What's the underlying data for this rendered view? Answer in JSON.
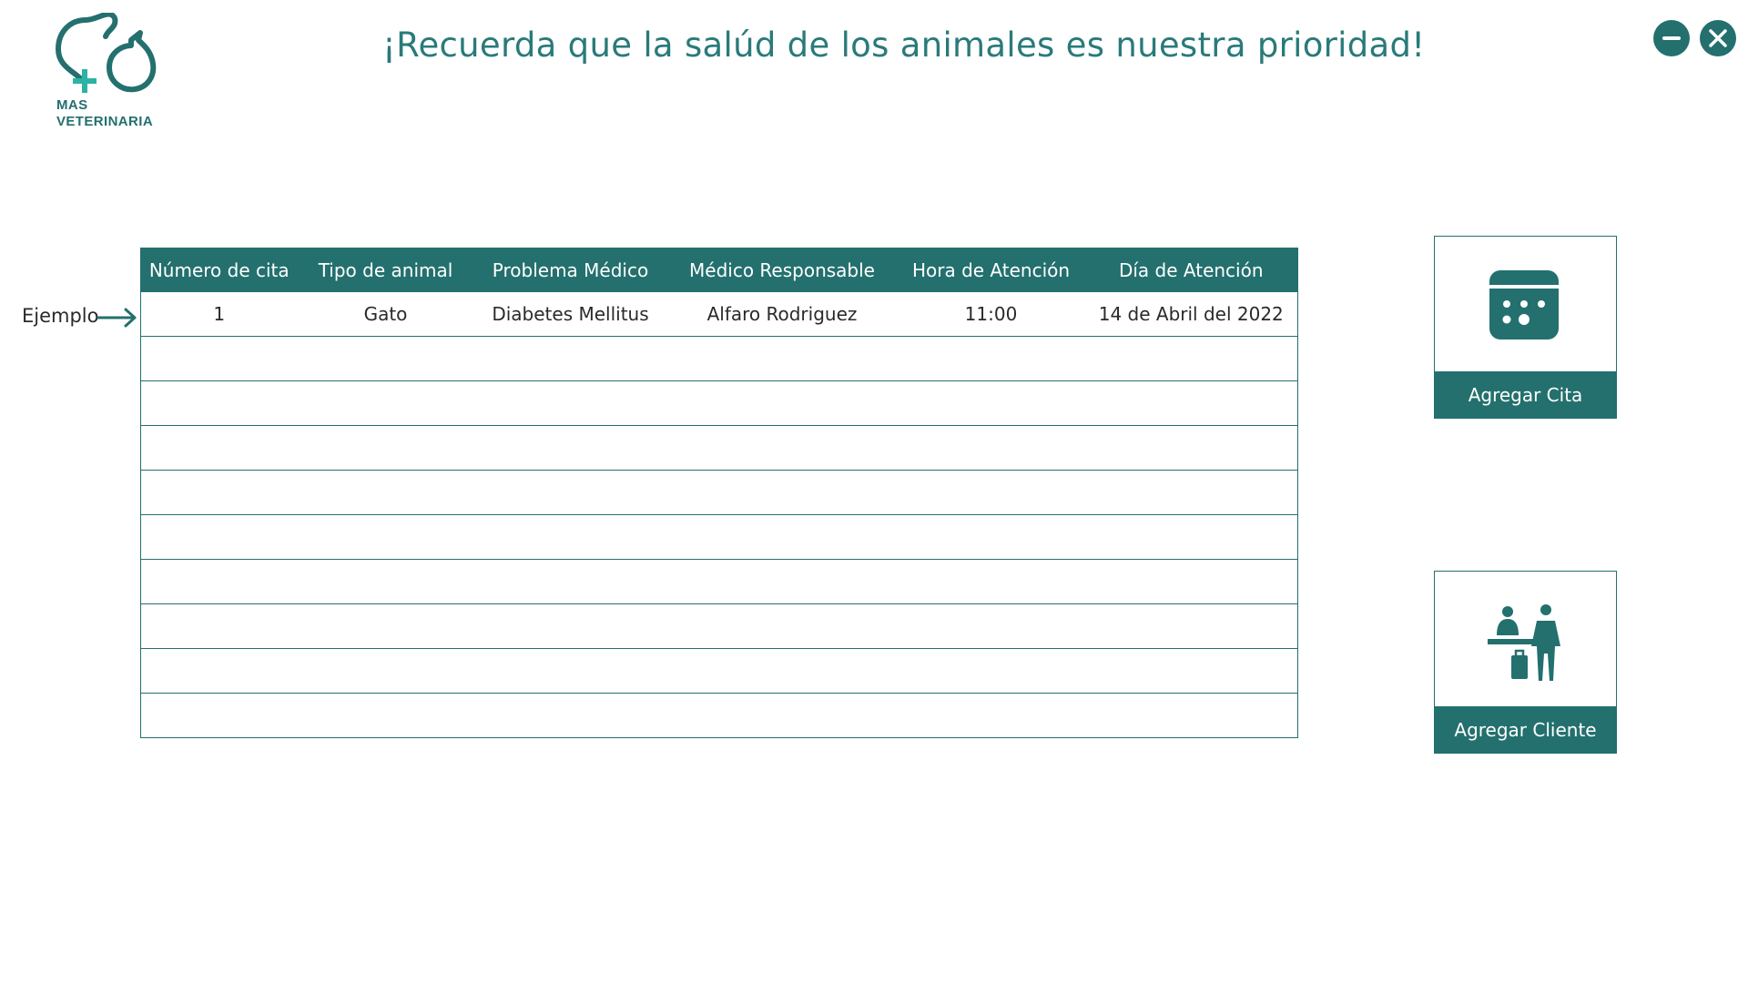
{
  "app": {
    "logo": {
      "line1": "MAS",
      "line2": "VETERINARIA"
    },
    "heading": "¡Recuerda que la salúd de los animales es nuestra prioridad!"
  },
  "window_controls": {
    "minimize_icon": "minus-icon",
    "close_icon": "close-icon"
  },
  "example_indicator": {
    "label": "Ejemplo",
    "icon": "arrow-right-icon"
  },
  "table": {
    "headers": [
      "Número de cita",
      "Tipo de animal",
      "Problema Médico",
      "Médico Responsable",
      "Hora de Atención",
      "Día de Atención"
    ],
    "rows": [
      [
        "1",
        "Gato",
        "Diabetes Mellitus",
        "Alfaro Rodriguez",
        "11:00",
        "14 de Abril del 2022"
      ],
      [
        "",
        "",
        "",
        "",
        "",
        ""
      ],
      [
        "",
        "",
        "",
        "",
        "",
        ""
      ],
      [
        "",
        "",
        "",
        "",
        "",
        ""
      ],
      [
        "",
        "",
        "",
        "",
        "",
        ""
      ],
      [
        "",
        "",
        "",
        "",
        "",
        ""
      ],
      [
        "",
        "",
        "",
        "",
        "",
        ""
      ],
      [
        "",
        "",
        "",
        "",
        "",
        ""
      ],
      [
        "",
        "",
        "",
        "",
        "",
        ""
      ],
      [
        "",
        "",
        "",
        "",
        "",
        ""
      ]
    ]
  },
  "actions": {
    "add_appointment": {
      "label": "Agregar Cita",
      "icon": "calendar-icon"
    },
    "add_client": {
      "label": "Agregar Cliente",
      "icon": "reception-desk-icon"
    }
  },
  "colors": {
    "primary": "#23706e",
    "heading": "#2a7a7a",
    "accent_cross": "#2bb3a5",
    "background": "#ffffff",
    "text": "#2a2a2a"
  }
}
